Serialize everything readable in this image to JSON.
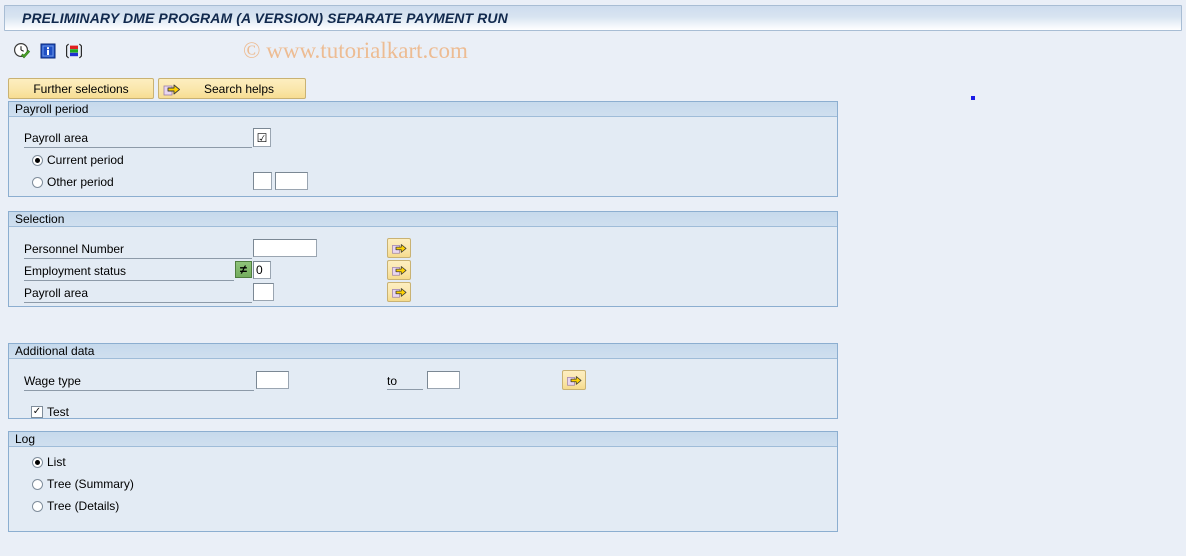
{
  "window": {
    "title": "PRELIMINARY DME PROGRAM (A VERSION) SEPARATE PAYMENT RUN"
  },
  "watermark": {
    "text": "© www.tutorialkart.com",
    "color": "#edbc93"
  },
  "toolbar": {
    "icons": [
      {
        "name": "clock-check-icon",
        "title": "Execute"
      },
      {
        "name": "information-icon",
        "title": "Information"
      },
      {
        "name": "color-bars-icon",
        "title": "Layout"
      }
    ]
  },
  "buttons": {
    "further_selections": "Further selections",
    "search_helps": "Search helps",
    "search_helps_icon": "arrow-right-icon"
  },
  "sections": {
    "payroll_period": {
      "title": "Payroll period",
      "payroll_area_label": "Payroll area",
      "payroll_area_value": "☑",
      "current_period_label": "Current period",
      "current_period_selected": true,
      "other_period_label": "Other period",
      "other_period_selected": false,
      "other_period_value_1": "",
      "other_period_value_2": ""
    },
    "selection": {
      "title": "Selection",
      "rows": [
        {
          "label": "Personnel Number",
          "value": "",
          "multi_icon": "multi-selection-icon"
        },
        {
          "label": "Employment status",
          "operator": "≠",
          "value": "0",
          "multi_icon": "multi-selection-icon"
        },
        {
          "label": "Payroll area",
          "value": "",
          "multi_icon": "multi-selection-icon"
        }
      ]
    },
    "additional_data": {
      "title": "Additional data",
      "wage_type_label": "Wage type",
      "wage_type_from": "",
      "to_label": "to",
      "wage_type_to": "",
      "multi_icon": "multi-selection-icon",
      "test_label": "Test",
      "test_checked": true,
      "test_mark": "✓"
    },
    "log": {
      "title": "Log",
      "options": [
        {
          "label": "List",
          "selected": true
        },
        {
          "label": "Tree (Summary)",
          "selected": false
        },
        {
          "label": "Tree (Details)",
          "selected": false
        }
      ]
    }
  },
  "colors": {
    "page_background": "#eaeff7",
    "panel_background": "#e3ebf4",
    "panel_border": "#8caed0",
    "panel_header": "#c6d9ec",
    "button_yellow": "#fae7ad",
    "title_text": "#11294d"
  }
}
